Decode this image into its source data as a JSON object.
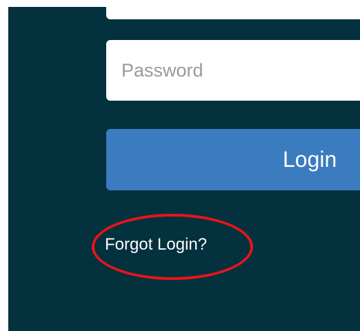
{
  "form": {
    "username_value": "",
    "password_value": "",
    "password_placeholder": "Password",
    "login_label": "Login",
    "forgot_label": "Forgot Login?"
  },
  "colors": {
    "panel_background": "#03313e",
    "login_button": "#3b7bbf",
    "annotation_ring": "#e8141c"
  }
}
